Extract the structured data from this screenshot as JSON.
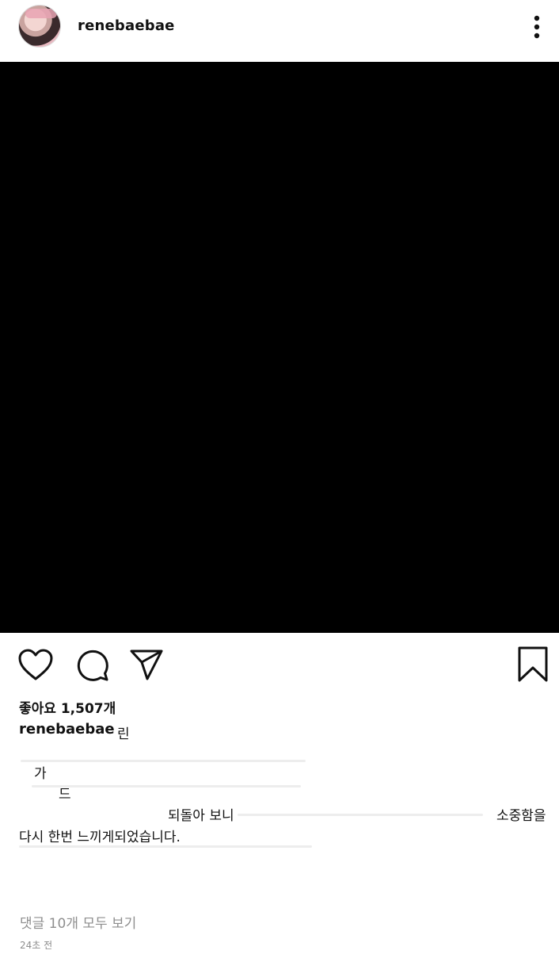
{
  "header": {
    "username": "renebaebae",
    "avatar_icon": "profile-avatar",
    "more_icon": "more-vertical-icon"
  },
  "post": {
    "likes_text": "좋아요 1,507개",
    "caption_user": "renebaebae",
    "caption_fragments": [
      "린",
      "가",
      "드",
      "되돌아 보니",
      "소중함을",
      "다시 한번 느끼게되었습니다."
    ],
    "view_comments": "댓글 10개 모두 보기",
    "time_ago": "24초 전"
  },
  "icons": {
    "like": "heart-icon",
    "comment": "comment-icon",
    "share": "send-icon",
    "save": "bookmark-icon"
  }
}
